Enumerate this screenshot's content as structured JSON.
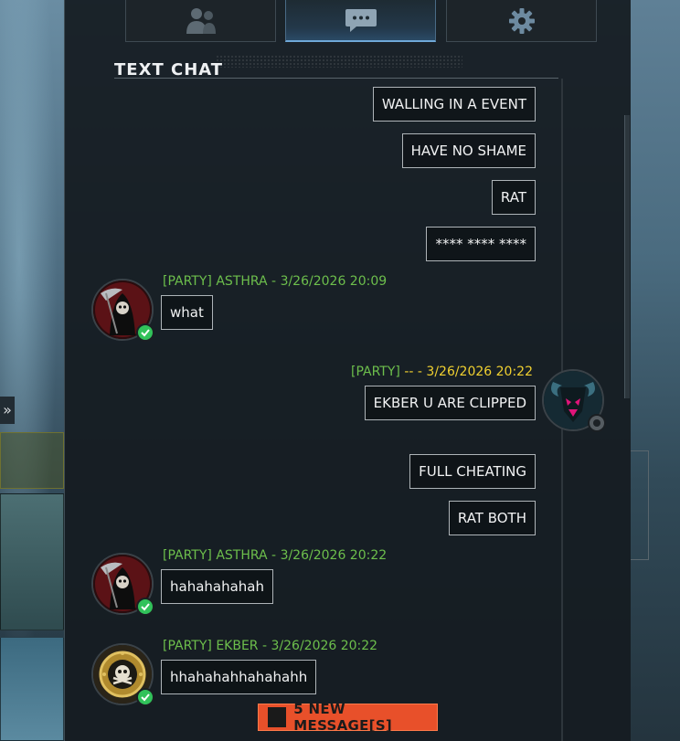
{
  "tabs": [
    {
      "name": "friends",
      "icon": "users-icon",
      "active": false
    },
    {
      "name": "chat",
      "icon": "chat-bubble-icon",
      "active": true
    },
    {
      "name": "settings",
      "icon": "gear-icon",
      "active": false
    }
  ],
  "section_title": "TEXT CHAT",
  "messages_top": [
    {
      "text": "WALLING IN A EVENT"
    },
    {
      "text": "HAVE NO SHAME"
    },
    {
      "text": "RAT"
    },
    {
      "text": "**** **** ****"
    }
  ],
  "msg_asthra_1": {
    "channel": "[PARTY]",
    "sender": "ASTHRA",
    "timestamp": "3/26/2026 20:09",
    "text": "what",
    "status": "online",
    "avatar": "reaper-avatar"
  },
  "msg_self": {
    "channel": "[PARTY]",
    "sender": "--",
    "timestamp": "3/26/2026 20:22",
    "text": "EKBER U ARE CLIPPED",
    "status": "offline",
    "avatar": "ram-skull-avatar"
  },
  "messages_mid": [
    {
      "text": "FULL CHEATING"
    },
    {
      "text": "RAT BOTH"
    }
  ],
  "msg_asthra_2": {
    "channel": "[PARTY]",
    "sender": "ASTHRA",
    "timestamp": "3/26/2026 20:22",
    "text": "hahahahahah",
    "status": "online",
    "avatar": "reaper-avatar"
  },
  "msg_ekber": {
    "channel": "[PARTY]",
    "sender": "EKBER",
    "timestamp": "3/26/2026 20:22",
    "text": "hhahahahhahahahh",
    "status": "online",
    "avatar": "skull-emblem-avatar"
  },
  "new_messages_label": "5 NEW MESSAGE[S]",
  "colors": {
    "party_green": "#6dbf4c",
    "self_yellow": "#f0d030",
    "alert_orange": "#e8502a",
    "online": "#31c25a"
  }
}
